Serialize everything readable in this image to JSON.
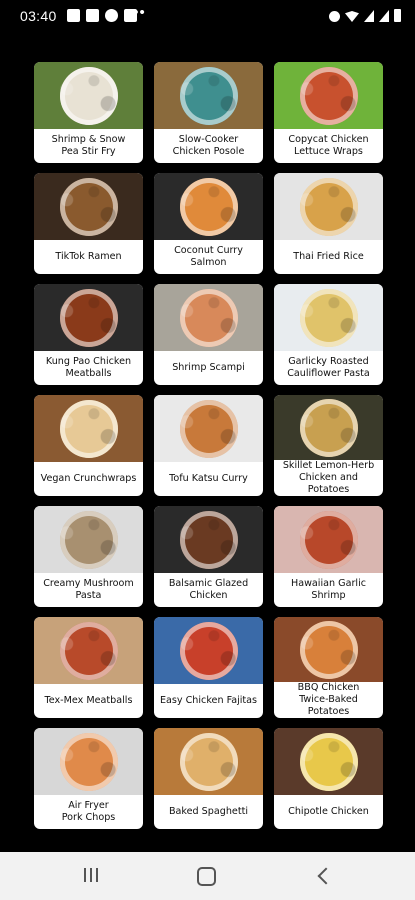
{
  "status_bar": {
    "time": "03:40",
    "left_icons": [
      "gallery-icon",
      "image-icon",
      "browser-icon",
      "app-icon"
    ],
    "overflow": "•••",
    "right_icons": [
      "alarm-icon",
      "wifi-icon",
      "signal-icon",
      "signal-icon",
      "battery-icon"
    ]
  },
  "recipes": [
    {
      "label": "Shrimp & Snow\nPea Stir Fry",
      "colors": [
        "#5f7f3a",
        "#e8e2d4"
      ]
    },
    {
      "label": "Slow-Cooker\nChicken Posole",
      "colors": [
        "#8a6a3c",
        "#3f8f8f"
      ]
    },
    {
      "label": "Copycat Chicken\nLettuce Wraps",
      "colors": [
        "#6fb33a",
        "#c8512e"
      ]
    },
    {
      "label": "TikTok Ramen",
      "colors": [
        "#3a2a1e",
        "#8a5a2e"
      ]
    },
    {
      "label": "Coconut Curry\nSalmon",
      "colors": [
        "#2a2a2a",
        "#e08a3a"
      ]
    },
    {
      "label": "Thai Fried Rice",
      "colors": [
        "#e4e4e4",
        "#d8a24a"
      ]
    },
    {
      "label": "Kung Pao Chicken\nMeatballs",
      "colors": [
        "#2a2a2a",
        "#8a3a1a"
      ]
    },
    {
      "label": "Shrimp Scampi",
      "colors": [
        "#a8a49a",
        "#d8895a"
      ]
    },
    {
      "label": "Garlicky Roasted\nCauliflower Pasta",
      "colors": [
        "#e8ecef",
        "#e0c36a"
      ]
    },
    {
      "label": "Vegan Crunchwraps",
      "colors": [
        "#8a5a32",
        "#e7c996"
      ]
    },
    {
      "label": "Tofu Katsu Curry",
      "colors": [
        "#e9e9e9",
        "#c8793a"
      ]
    },
    {
      "label": "Skillet Lemon-Herb\nChicken and Potatoes",
      "colors": [
        "#3a3a2a",
        "#c8a050"
      ]
    },
    {
      "label": "Creamy Mushroom\nPasta",
      "colors": [
        "#dcdcdc",
        "#a89070"
      ]
    },
    {
      "label": "Balsamic Glazed\nChicken",
      "colors": [
        "#2a2a2a",
        "#6a3a22"
      ]
    },
    {
      "label": "Hawaiian Garlic\nShrimp",
      "colors": [
        "#d9b6b0",
        "#b8482a"
      ]
    },
    {
      "label": "Tex-Mex Meatballs",
      "colors": [
        "#c7a27a",
        "#b84a2a"
      ]
    },
    {
      "label": "Easy Chicken Fajitas",
      "colors": [
        "#3a6aa8",
        "#c8402a"
      ]
    },
    {
      "label": "BBQ Chicken\nTwice-Baked Potatoes",
      "colors": [
        "#8a4a2a",
        "#d8803a"
      ]
    },
    {
      "label": "Air Fryer\nPork Chops",
      "colors": [
        "#d7d7d7",
        "#e08a4a"
      ]
    },
    {
      "label": "Baked Spaghetti",
      "colors": [
        "#b87a3a",
        "#e0b06a"
      ]
    },
    {
      "label": "Chipotle Chicken",
      "colors": [
        "#5a3a2a",
        "#e8c84a"
      ]
    }
  ],
  "nav": {
    "recents": "recents-icon",
    "home": "home-icon",
    "back": "back-icon"
  }
}
